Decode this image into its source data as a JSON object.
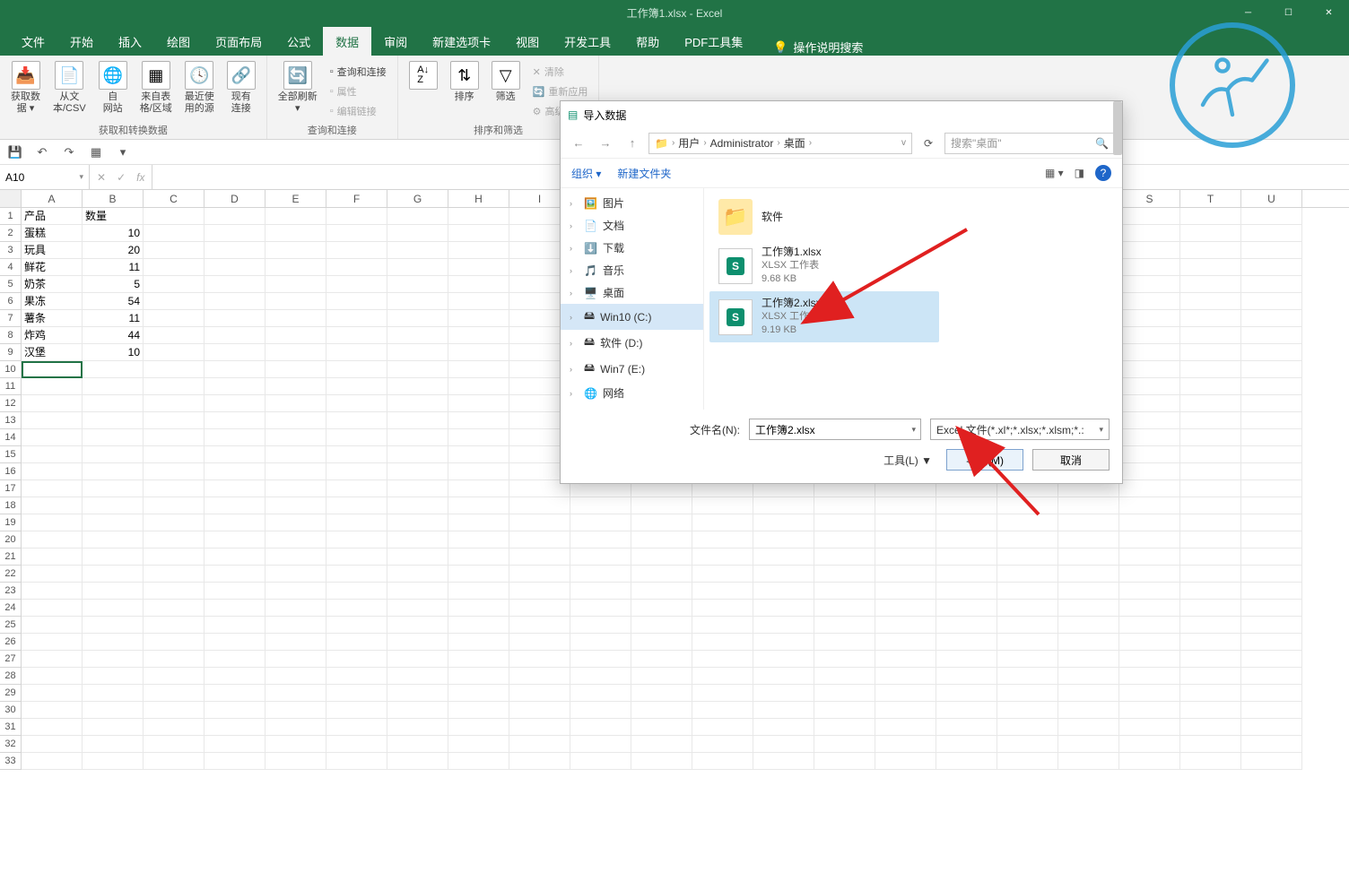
{
  "titlebar": {
    "text": "工作簿1.xlsx - Excel"
  },
  "tabs": [
    "文件",
    "开始",
    "插入",
    "绘图",
    "页面布局",
    "公式",
    "数据",
    "审阅",
    "新建选项卡",
    "视图",
    "开发工具",
    "帮助",
    "PDF工具集"
  ],
  "active_tab_index": 6,
  "tellme": "操作说明搜索",
  "ribbon": {
    "group1": {
      "label": "获取和转换数据",
      "btns": [
        {
          "l1": "获取数",
          "l2": "据 ▾"
        },
        {
          "l1": "从文",
          "l2": "本/CSV"
        },
        {
          "l1": "自",
          "l2": "网站"
        },
        {
          "l1": "来自表",
          "l2": "格/区域"
        },
        {
          "l1": "最近使",
          "l2": "用的源"
        },
        {
          "l1": "现有",
          "l2": "连接"
        }
      ]
    },
    "group2": {
      "label": "查询和连接",
      "main": {
        "l1": "全部刷新",
        "l2": "▾"
      },
      "side": [
        "查询和连接",
        "属性",
        "编辑链接"
      ]
    },
    "group3": {
      "label": "排序和筛选",
      "sort": "排序",
      "filter": "筛选",
      "side": [
        "清除",
        "重新应用",
        "高级"
      ]
    }
  },
  "namebox": "A10",
  "columns": [
    "A",
    "B",
    "C",
    "D",
    "E",
    "F",
    "G",
    "H",
    "S"
  ],
  "sheet": {
    "header": [
      "产品",
      "数量"
    ],
    "rows": [
      [
        "蛋糕",
        "10"
      ],
      [
        "玩具",
        "20"
      ],
      [
        "鲜花",
        "11"
      ],
      [
        "奶茶",
        "5"
      ],
      [
        "果冻",
        "54"
      ],
      [
        "薯条",
        "11"
      ],
      [
        "炸鸡",
        "44"
      ],
      [
        "汉堡",
        "10"
      ]
    ],
    "row_count": 33,
    "selected_cell": "A10"
  },
  "dialog": {
    "title": "导入数据",
    "breadcrumb": [
      "用户",
      "Administrator",
      "桌面"
    ],
    "search_placeholder": "搜索\"桌面\"",
    "organize": "组织 ▾",
    "newfolder": "新建文件夹",
    "tree": [
      {
        "label": "图片",
        "icon": "🖼️"
      },
      {
        "label": "文档",
        "icon": "📄"
      },
      {
        "label": "下载",
        "icon": "⬇️"
      },
      {
        "label": "音乐",
        "icon": "🎵"
      },
      {
        "label": "桌面",
        "icon": "🖥️"
      },
      {
        "label": "Win10 (C:)",
        "icon": "🖴",
        "selected": true
      },
      {
        "label": "软件 (D:)",
        "icon": "🖴"
      },
      {
        "label": "Win7 (E:)",
        "icon": "🖴"
      },
      {
        "label": "网络",
        "icon": "🌐"
      }
    ],
    "files": [
      {
        "name": "软件",
        "type": "",
        "size": "",
        "kind": "folder"
      },
      {
        "name": "工作簿1.xlsx",
        "type": "XLSX 工作表",
        "size": "9.68 KB",
        "kind": "xlsx"
      },
      {
        "name": "工作簿2.xlsx",
        "type": "XLSX 工作表",
        "size": "9.19 KB",
        "kind": "xlsx",
        "selected": true
      }
    ],
    "filename_label": "文件名(N):",
    "filename_value": "工作簿2.xlsx",
    "filter": "Excel 文件(*.xl*;*.xlsx;*.xlsm;*.:",
    "tools": "工具(L) ▼",
    "import_btn": "导入(M)",
    "cancel_btn": "取消"
  }
}
